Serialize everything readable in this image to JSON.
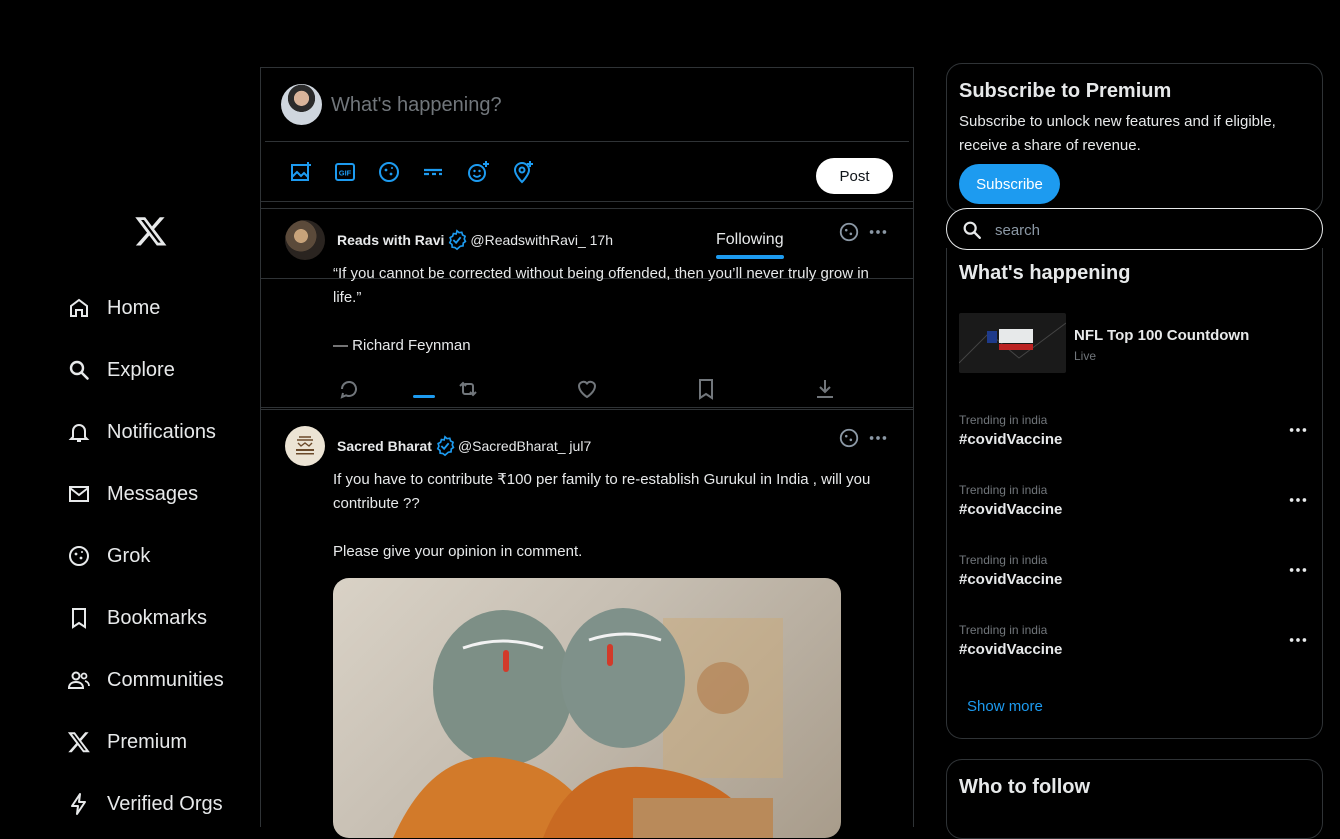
{
  "nav": {
    "logo": "x-logo",
    "items": [
      {
        "label": "Home",
        "icon": "home-icon"
      },
      {
        "label": "Explore",
        "icon": "search-icon"
      },
      {
        "label": "Notifications",
        "icon": "bell-icon"
      },
      {
        "label": "Messages",
        "icon": "mail-icon"
      },
      {
        "label": "Grok",
        "icon": "grok-icon"
      },
      {
        "label": "Bookmarks",
        "icon": "bookmark-icon"
      },
      {
        "label": "Communities",
        "icon": "people-icon"
      },
      {
        "label": "Premium",
        "icon": "x-premium-icon"
      },
      {
        "label": "Verified Orgs",
        "icon": "lightning-icon"
      }
    ]
  },
  "composer": {
    "placeholder": "What's happening?",
    "post_label": "Post",
    "tools": [
      "image-icon",
      "gif-icon",
      "grok-icon",
      "poll-icon",
      "emoji-icon",
      "location-icon"
    ]
  },
  "tabs": {
    "following": "Following"
  },
  "posts": [
    {
      "name": "Reads with Ravi",
      "handle_time": "@ReadswithRavi_ 17h",
      "body": "“If you cannot be corrected without being offended, then you’ll never truly grow in life.”\n\n— Richard Feynman"
    },
    {
      "name": "Sacred Bharat",
      "handle_time": "@SacredBharat_ jul7",
      "body": "If you have to contribute ₹100 per family to re-establish Gurukul in India , will you contribute ??\n\nPlease give your opinion in comment."
    }
  ],
  "premium": {
    "title": "Subscribe to Premium",
    "text": "Subscribe to unlock new features and if eligible, receive a share of revenue.",
    "button": "Subscribe"
  },
  "search": {
    "placeholder": "search"
  },
  "happening": {
    "title": "What's happening",
    "featured": {
      "title": "NFL Top 100 Countdown",
      "status": "Live"
    },
    "trends": [
      {
        "context": "Trending in india",
        "tag": "#covidVaccine"
      },
      {
        "context": "Trending in india",
        "tag": "#covidVaccine"
      },
      {
        "context": "Trending in india",
        "tag": "#covidVaccine"
      },
      {
        "context": "Trending in india",
        "tag": "#covidVaccine"
      }
    ],
    "show_more": "Show more"
  },
  "who_to_follow": {
    "title": "Who to follow"
  },
  "colors": {
    "accent": "#1d9bf0",
    "background": "#000000",
    "border": "#2f3336",
    "muted": "#71767b"
  }
}
